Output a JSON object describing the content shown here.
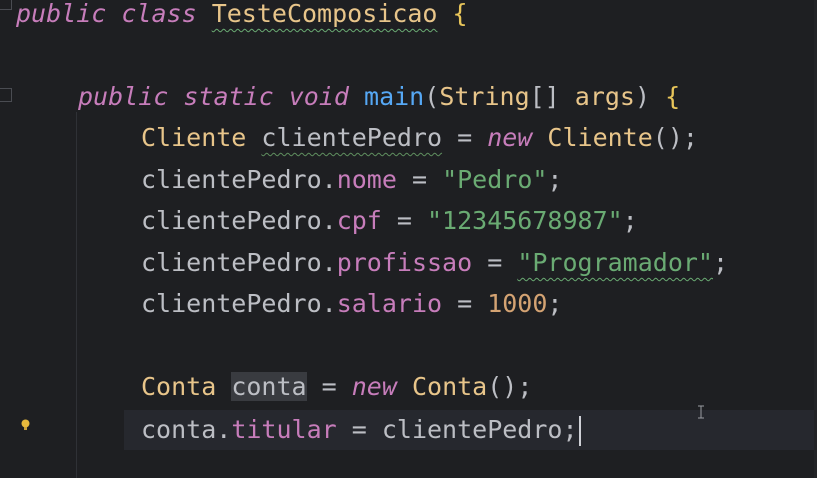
{
  "editor": {
    "language": "java",
    "colors": {
      "background": "#1e1f22",
      "keyword": "#cf8e6d",
      "class_name": "#e8c58a",
      "method": "#56a8f5",
      "field": "#c77dbb",
      "string": "#6aab73",
      "number": "#d4a373",
      "text": "#bcbec4"
    },
    "lines": [
      {
        "tokens": [
          {
            "t": "public",
            "c": "kw-purple"
          },
          {
            "t": " ",
            "c": "plain"
          },
          {
            "t": "class",
            "c": "kw-purple"
          },
          {
            "t": " ",
            "c": "plain"
          },
          {
            "t": "TesteComposicao",
            "c": "cls squiggle"
          },
          {
            "t": " ",
            "c": "plain"
          },
          {
            "t": "{",
            "c": "brace"
          }
        ]
      },
      {
        "tokens": []
      },
      {
        "tokens": [
          {
            "t": "public",
            "c": "kw-purple"
          },
          {
            "t": " ",
            "c": "plain"
          },
          {
            "t": "static",
            "c": "kw-purple"
          },
          {
            "t": " ",
            "c": "plain"
          },
          {
            "t": "void",
            "c": "kw-purple"
          },
          {
            "t": " ",
            "c": "plain"
          },
          {
            "t": "main",
            "c": "fn"
          },
          {
            "t": "(",
            "c": "plain"
          },
          {
            "t": "String",
            "c": "cls"
          },
          {
            "t": "[] ",
            "c": "plain"
          },
          {
            "t": "args",
            "c": "cls"
          },
          {
            "t": ") ",
            "c": "plain"
          },
          {
            "t": "{",
            "c": "brace"
          }
        ]
      },
      {
        "tokens": [
          {
            "t": "Cliente",
            "c": "cls"
          },
          {
            "t": " ",
            "c": "plain"
          },
          {
            "t": "clientePedro",
            "c": "plain squiggle-grey"
          },
          {
            "t": " = ",
            "c": "plain"
          },
          {
            "t": "new",
            "c": "kw-purple"
          },
          {
            "t": " ",
            "c": "plain"
          },
          {
            "t": "Cliente",
            "c": "cls"
          },
          {
            "t": "();",
            "c": "plain"
          }
        ]
      },
      {
        "tokens": [
          {
            "t": "clientePedro",
            "c": "plain"
          },
          {
            "t": ".",
            "c": "plain"
          },
          {
            "t": "nome",
            "c": "field"
          },
          {
            "t": " = ",
            "c": "plain"
          },
          {
            "t": "\"Pedro\"",
            "c": "str"
          },
          {
            "t": ";",
            "c": "plain"
          }
        ]
      },
      {
        "tokens": [
          {
            "t": "clientePedro",
            "c": "plain"
          },
          {
            "t": ".",
            "c": "plain"
          },
          {
            "t": "cpf",
            "c": "field"
          },
          {
            "t": " = ",
            "c": "plain"
          },
          {
            "t": "\"12345678987\"",
            "c": "str"
          },
          {
            "t": ";",
            "c": "plain"
          }
        ]
      },
      {
        "tokens": [
          {
            "t": "clientePedro",
            "c": "plain"
          },
          {
            "t": ".",
            "c": "plain"
          },
          {
            "t": "profissao",
            "c": "field"
          },
          {
            "t": " = ",
            "c": "plain"
          },
          {
            "t": "\"Programador\"",
            "c": "str squiggle"
          },
          {
            "t": ";",
            "c": "plain"
          }
        ]
      },
      {
        "tokens": [
          {
            "t": "clientePedro",
            "c": "plain"
          },
          {
            "t": ".",
            "c": "plain"
          },
          {
            "t": "salario",
            "c": "field"
          },
          {
            "t": " = ",
            "c": "plain"
          },
          {
            "t": "1000",
            "c": "num"
          },
          {
            "t": ";",
            "c": "plain"
          }
        ]
      },
      {
        "tokens": []
      },
      {
        "tokens": [
          {
            "t": "Conta",
            "c": "cls"
          },
          {
            "t": " ",
            "c": "plain"
          },
          {
            "t": "conta",
            "c": "plain var-highlight"
          },
          {
            "t": " = ",
            "c": "plain"
          },
          {
            "t": "new",
            "c": "kw-purple"
          },
          {
            "t": " ",
            "c": "plain"
          },
          {
            "t": "Conta",
            "c": "cls"
          },
          {
            "t": "();",
            "c": "plain"
          }
        ]
      },
      {
        "tokens": [
          {
            "t": "conta",
            "c": "plain"
          },
          {
            "t": ".",
            "c": "plain"
          },
          {
            "t": "titular",
            "c": "field"
          },
          {
            "t": " = ",
            "c": "plain"
          },
          {
            "t": "clientePedro",
            "c": "plain"
          },
          {
            "t": ";",
            "c": "plain"
          }
        ],
        "caret": true
      }
    ],
    "gutter_icon": "lightbulb-icon",
    "cursor_icon": "text-ibeam-icon"
  }
}
